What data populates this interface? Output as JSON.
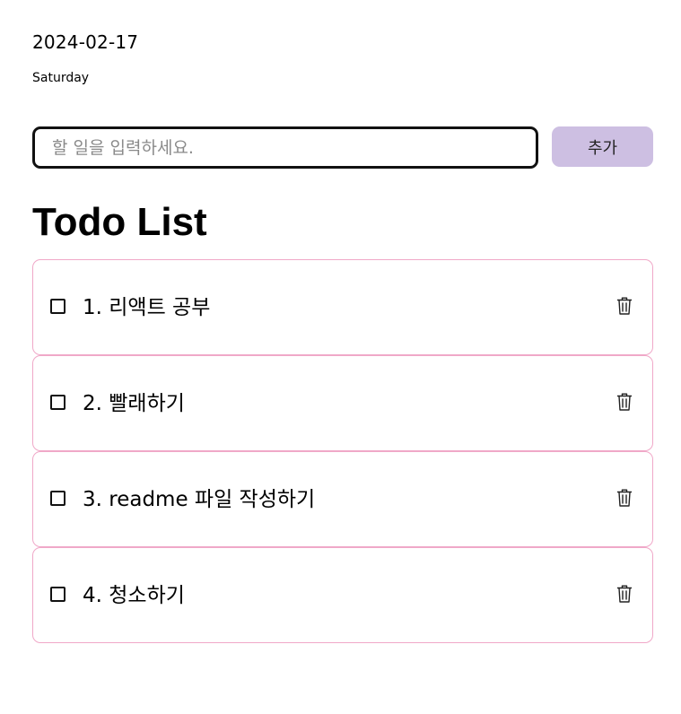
{
  "header": {
    "date": "2024-02-17",
    "weekday": "Saturday"
  },
  "input": {
    "value": "",
    "placeholder": "할 일을 입력하세요."
  },
  "add_button": {
    "label": "추가",
    "color": "#cdbfe2"
  },
  "list": {
    "title": "Todo List",
    "border_color": "#f0a8c8",
    "items": [
      {
        "text": "1. 리액트 공부",
        "checked": false,
        "icon": "trash-icon"
      },
      {
        "text": "2. 빨래하기",
        "checked": false,
        "icon": "trash-icon"
      },
      {
        "text": "3. readme 파일 작성하기",
        "checked": false,
        "icon": "trash-icon"
      },
      {
        "text": "4. 청소하기",
        "checked": false,
        "icon": "trash-icon"
      }
    ]
  }
}
